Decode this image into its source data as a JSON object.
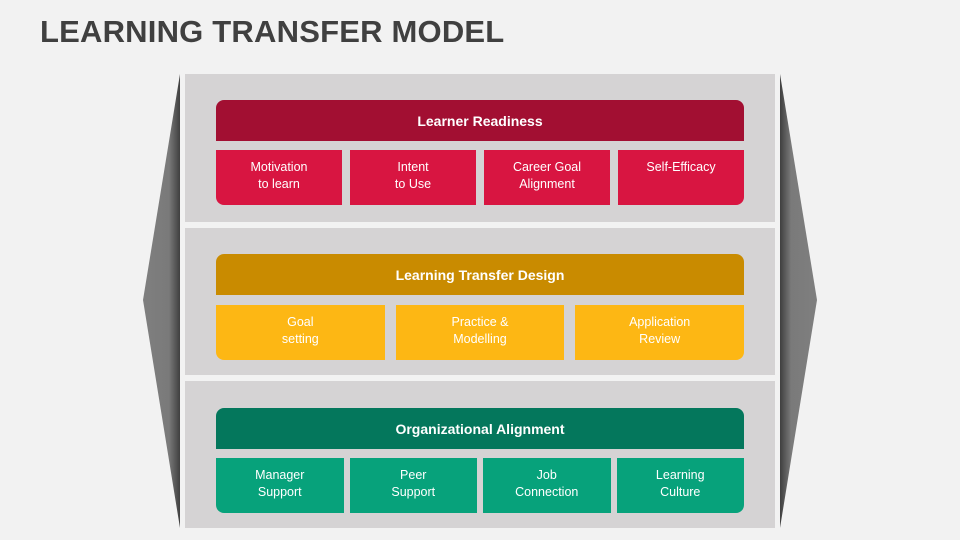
{
  "title": "LEARNING TRANSFER MODEL",
  "colors": {
    "readiness_header": "#a20f32",
    "readiness_cell": "#d81541",
    "design_header": "#c98b00",
    "design_cell": "#fdb714",
    "alignment_header": "#04775c",
    "alignment_cell": "#07a27b",
    "panel_bg": "#d5d3d4",
    "side_shape": "#7f7f7f"
  },
  "sections": [
    {
      "header": "Learner Readiness",
      "items": [
        "Motivation\nto learn",
        "Intent\nto Use",
        "Career Goal\nAlignment",
        "Self-Efficacy"
      ]
    },
    {
      "header": "Learning Transfer Design",
      "items": [
        "Goal\nsetting",
        "Practice &\nModelling",
        "Application\nReview"
      ]
    },
    {
      "header": "Organizational Alignment",
      "items": [
        "Manager\nSupport",
        "Peer\nSupport",
        "Job\nConnection",
        "Learning\nCulture"
      ]
    }
  ]
}
